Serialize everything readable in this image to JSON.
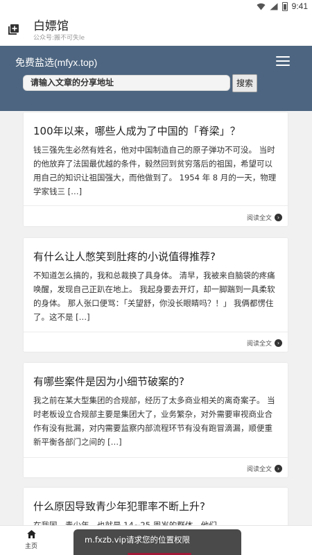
{
  "status_bar": {
    "time": "9:41"
  },
  "header": {
    "title": "白嫖馆",
    "subtitle": "公众号:搬不可失le"
  },
  "banner": {
    "site_title": "免费盐选(mfyx.top)",
    "search_placeholder": "请输入文章的分享地址",
    "search_button": "搜索"
  },
  "articles": [
    {
      "title": "100年以来，哪些人成为了中国的「脊梁」？",
      "excerpt": "钱三强先生必然有姓名，他对中国制造自己的原子弹功不可没。 当时的他放弃了法国最优越的条件，毅然回到贫穷落后的祖国，希望可以用自己的知识让祖国强大，而他做到了。 1954 年 8 月的一天，物理学家钱三 […]",
      "read_more": "阅读全文"
    },
    {
      "title": "有什么让人憋笑到肚疼的小说值得推荐?",
      "excerpt": "不知道怎么搞的，我和总裁换了具身体。 清早，我被来自脑袋的疼痛唤醒，发现自己正趴在地上。 我起身要去开灯，却一脚踹到一具柔软的身体。 那人张口便骂：「关望舒，你没长眼睛吗？！」 我俩都愣住了。这不是 […]",
      "read_more": "阅读全文"
    },
    {
      "title": "有哪些案件是因为小细节破案的?",
      "excerpt": "我之前在某大型集团的合规部，经历了太多商业相关的离奇案子。 当时老板设立合规部主要是集团大了，业务繁杂，对外需要审视商业合作有没有批漏，对内需要监察内部流程环节有没有跑冒滴漏，顺便重新平衡各部门之间的 […]",
      "read_more": "阅读全文"
    },
    {
      "title": "什么原因导致青少年犯罪率不断上升?",
      "excerpt": "在我国，青少年，也就是 14~25 周岁的群体，他们",
      "read_more": ""
    }
  ],
  "bottom_nav": {
    "home_label": "主页"
  },
  "toast": {
    "text": "m.fxzb.vip请求您的位置权限"
  }
}
